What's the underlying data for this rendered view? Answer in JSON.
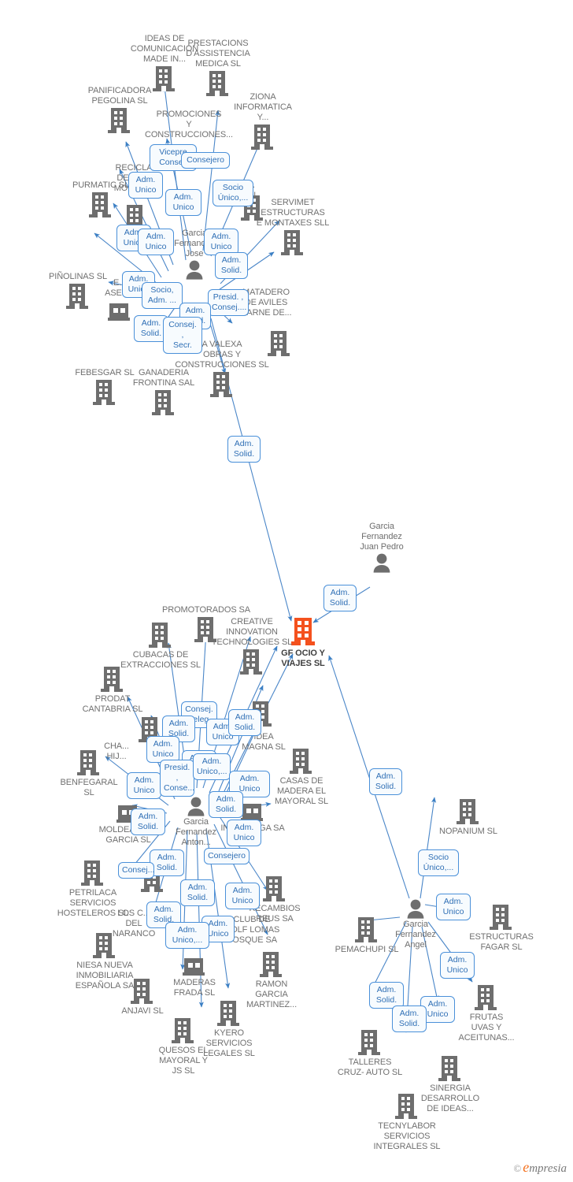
{
  "meta": {
    "watermark_c": "©",
    "watermark_brand_first": "e",
    "watermark_brand_rest": "mpresia",
    "accent_color": "#f4511e",
    "node_color": "#6e6e6e",
    "edge_color": "#4a86c8",
    "chip_border_color": "#4a90d9",
    "chip_text_color": "#2f6fb5"
  },
  "center": {
    "label": "GF OCIO Y\nVIAJES SL",
    "type": "company-highlight"
  },
  "people": [
    {
      "id": "p_jose",
      "label": "Garcia\nFernandez\nJose"
    },
    {
      "id": "p_juan",
      "label": "Garcia\nFernandez\nJuan Pedro"
    },
    {
      "id": "p_anton",
      "label": "Garcia\nFernandez\nAnton..."
    },
    {
      "id": "p_angel",
      "label": "Garcia\nFernandez\nAngel"
    }
  ],
  "companies": [
    {
      "id": "c01",
      "label": "IDEAS DE\nCOMUNICACION\nMADE IN..."
    },
    {
      "id": "c02",
      "label": "PRESTACIONS\nD'ASSISTENCIA\nMEDICA SL"
    },
    {
      "id": "c03",
      "label": "PANIFICADORA\nPEGOLINA SL"
    },
    {
      "id": "c04",
      "label": "ZIONA\nINFORMATICA\nY..."
    },
    {
      "id": "c05",
      "label": "PROMOCIONES\nY\nCONSTRUCCIONES..."
    },
    {
      "id": "c06",
      "label": "PURMATIC SL"
    },
    {
      "id": "c07",
      "label": "RECICLA\nDE ME...\nMORQU..."
    },
    {
      "id": "c08",
      "label": "RE...\nON SL"
    },
    {
      "id": "c09",
      "label": "SERVIMET\nESTRUCTURAS\nE MONTAXES SLL"
    },
    {
      "id": "c10",
      "label": "PIÑOLINAS SL"
    },
    {
      "id": "c11",
      "label": "E...\nASES..."
    },
    {
      "id": "c12",
      "label": "MATADERO\nDE AVILES\nCARNE DE..."
    },
    {
      "id": "c13",
      "label": "A VALEXA\nOBRAS Y\nCONSTRUCCIONES SL"
    },
    {
      "id": "c14",
      "label": "FEBESGAR SL"
    },
    {
      "id": "c15",
      "label": "GANADERIA\nFRONTINA SAL"
    },
    {
      "id": "c16",
      "label": "PROMOTORADOS SA"
    },
    {
      "id": "c17",
      "label": "CUBACAS DE\nEXTRACCIONES SL"
    },
    {
      "id": "c18",
      "label": "CREATIVE\nINNOVATION\nTECHNOLOGIES SL"
    },
    {
      "id": "c19",
      "label": "PRODAT\nCANTABRIA  SL"
    },
    {
      "id": "c20",
      "label": "CHA...\nHIJ..."
    },
    {
      "id": "c21",
      "label": "IDEA\nMAGNA SL"
    },
    {
      "id": "c22",
      "label": "BENFEGARAL\nSL"
    },
    {
      "id": "c23",
      "label": "CASAS DE\nMADERA EL\nMAYORAL  SL"
    },
    {
      "id": "c24",
      "label": "MOLDEANTES\nGARCIA SL"
    },
    {
      "id": "c25",
      "label": "INTERROGA SA"
    },
    {
      "id": "c26",
      "label": "PETRILACA\nSERVICIOS\nHOSTELEROS SL"
    },
    {
      "id": "c27",
      "label": "LOS C...\nDEL\nNARANCO"
    },
    {
      "id": "c28",
      "label": "RECAMBIOS\nREUS SA"
    },
    {
      "id": "c29",
      "label": "NIESA NUEVA\nINMOBILIARIA\nESPAÑOLA SA"
    },
    {
      "id": "c30",
      "label": "CLUB DE\nGOLF LOMAS\nBOSQUE SA"
    },
    {
      "id": "c31",
      "label": "MADERAS\nFRADA SL"
    },
    {
      "id": "c32",
      "label": "ANJAVI  SL"
    },
    {
      "id": "c33",
      "label": "RAMON\nGARCIA\nMARTINEZ..."
    },
    {
      "id": "c34",
      "label": "QUESOS EL\nMAYORAL Y\nJS  SL"
    },
    {
      "id": "c35",
      "label": "KYERO\nSERVICIOS\nLEGALES SL"
    },
    {
      "id": "c36",
      "label": "NOPANIUM SL"
    },
    {
      "id": "c37",
      "label": "ESTRUCTURAS\nFAGAR SL"
    },
    {
      "id": "c38",
      "label": "PEMACHUPI  SL"
    },
    {
      "id": "c39",
      "label": "FRUTAS\nUVAS Y\nACEITUNAS..."
    },
    {
      "id": "c40",
      "label": "TALLERES\nCRUZ- AUTO  SL"
    },
    {
      "id": "c41",
      "label": "SINERGIA\nDESARROLLO\nDE IDEAS..."
    },
    {
      "id": "c42",
      "label": "TECNYLABOR\nSERVICIOS\nINTEGRALES SL"
    }
  ],
  "relations": [
    {
      "id": "r01",
      "label": "Vicepre\nConsej."
    },
    {
      "id": "r02",
      "label": "Consejero"
    },
    {
      "id": "r03",
      "label": "Adm.\nUnico"
    },
    {
      "id": "r04",
      "label": "Adm.\nUnico"
    },
    {
      "id": "r05",
      "label": "Socio\nÚnico,..."
    },
    {
      "id": "r06",
      "label": "Adm.\nUnico"
    },
    {
      "id": "r07",
      "label": "Adm.\nUnico"
    },
    {
      "id": "r08",
      "label": "Adm.\nUnico"
    },
    {
      "id": "r09",
      "label": "Adm.\nSolid."
    },
    {
      "id": "r10",
      "label": "Adm.\nUnico"
    },
    {
      "id": "r11",
      "label": "Socio,\nAdm. ..."
    },
    {
      "id": "r12",
      "label": "Presid. ,\nConsej...."
    },
    {
      "id": "r13",
      "label": "Adm.\nSolid."
    },
    {
      "id": "r14",
      "label": "Adm.\nSolid."
    },
    {
      "id": "r15",
      "label": "Consej. ,\nSecr."
    },
    {
      "id": "r16",
      "label": "Adm.\nSolid."
    },
    {
      "id": "r17",
      "label": "Adm.\nSolid."
    },
    {
      "id": "r18",
      "label": "Consej.\nDeleg."
    },
    {
      "id": "r19",
      "label": "Adm.\nSolid."
    },
    {
      "id": "r20",
      "label": "Adm.\nUnico"
    },
    {
      "id": "r21",
      "label": "Adm.\nSolid."
    },
    {
      "id": "r22",
      "label": "Adm.\nUnico"
    },
    {
      "id": "r23",
      "label": "Adm.\nUnico"
    },
    {
      "id": "r24",
      "label": "Adm.\nUnico"
    },
    {
      "id": "r25",
      "label": "Presid. ,\nConse..."
    },
    {
      "id": "r26",
      "label": "Adm.\nUnico,..."
    },
    {
      "id": "r27",
      "label": "Adm.\nUnico"
    },
    {
      "id": "r28",
      "label": "Adm.\nSolid."
    },
    {
      "id": "r29",
      "label": "Adm.\nSolid."
    },
    {
      "id": "r30",
      "label": "Adm.\nUnico"
    },
    {
      "id": "r31",
      "label": "Adm.\nSolid."
    },
    {
      "id": "r32",
      "label": "Adm.\nUnico"
    },
    {
      "id": "r33",
      "label": "Consej..."
    },
    {
      "id": "r34",
      "label": "Consejero"
    },
    {
      "id": "r35",
      "label": "Adm.\nSolid."
    },
    {
      "id": "r36",
      "label": "Adm.\nUnico"
    },
    {
      "id": "r37",
      "label": "Adm.\nSolid."
    },
    {
      "id": "r38",
      "label": "Adm.\nUnico"
    },
    {
      "id": "r39",
      "label": "Adm.\nUnico"
    },
    {
      "id": "r40",
      "label": "Adm.\nUnico,..."
    },
    {
      "id": "r41",
      "label": "Adm.\nUnico"
    },
    {
      "id": "r42",
      "label": "Adm.\nSolid."
    },
    {
      "id": "r43",
      "label": "Socio\nÚnico,..."
    },
    {
      "id": "r44",
      "label": "Adm.\nUnico"
    },
    {
      "id": "r45",
      "label": "Adm.\nUnico"
    },
    {
      "id": "r46",
      "label": "Adm.\nSolid."
    },
    {
      "id": "r47",
      "label": "Adm.\nUnico"
    },
    {
      "id": "r48",
      "label": "Adm.\nSolid."
    },
    {
      "id": "r49",
      "label": "Adm.\nSolid."
    }
  ]
}
